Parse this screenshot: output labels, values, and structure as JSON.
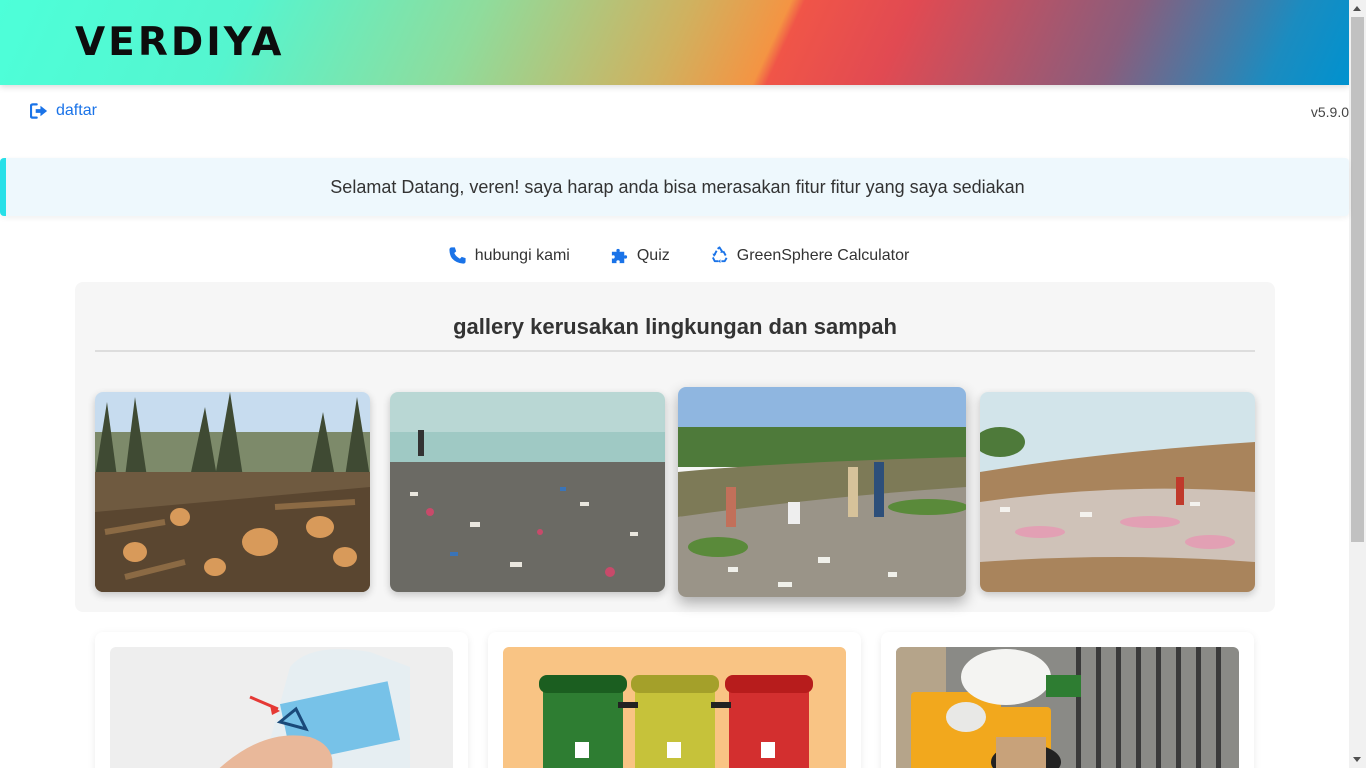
{
  "header": {
    "brand": "VERDIYA"
  },
  "topbar": {
    "register_label": "daftar",
    "version": "v5.9.0"
  },
  "welcome": {
    "message": "Selamat Datang, veren! saya harap anda bisa merasakan fitur fitur yang saya sediakan"
  },
  "nav": {
    "items": [
      {
        "label": "hubungi kami",
        "icon": "phone-icon"
      },
      {
        "label": "Quiz",
        "icon": "puzzle-icon"
      },
      {
        "label": "GreenSphere Calculator",
        "icon": "recycle-icon"
      }
    ]
  },
  "gallery": {
    "title": "gallery kerusakan lingkungan dan sampah",
    "images": [
      {
        "subject": "deforestation"
      },
      {
        "subject": "trash-beach"
      },
      {
        "subject": "riverbank-waste"
      },
      {
        "subject": "landfill"
      }
    ]
  },
  "cards": [
    {
      "subject": "plastic-bottle-recycle"
    },
    {
      "subject": "waste-bins"
    },
    {
      "subject": "garbage-pile"
    }
  ],
  "colors": {
    "link": "#1a73e8",
    "banner_accent": "#28e0e8",
    "banner_bg": "#eef8fd"
  }
}
